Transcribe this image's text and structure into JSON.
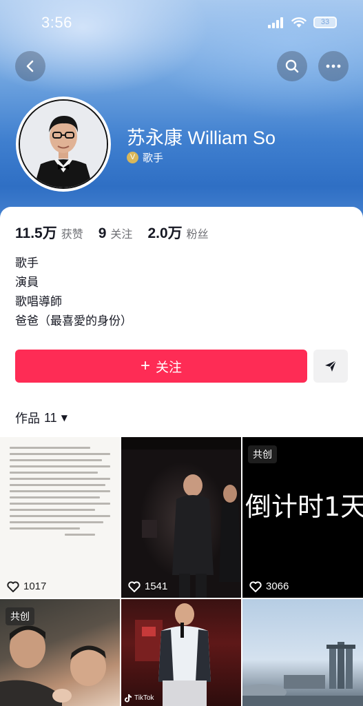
{
  "status_bar": {
    "time": "3:56",
    "battery": "33"
  },
  "profile": {
    "name": "苏永康 William So",
    "verified_label": "歌手",
    "verified_mark": "V"
  },
  "stats": [
    {
      "value": "11.5万",
      "label": "获赞"
    },
    {
      "value": "9",
      "label": "关注"
    },
    {
      "value": "2.0万",
      "label": "粉丝"
    }
  ],
  "bio": [
    "歌手",
    "演員",
    "歌唱導師",
    "爸爸（最喜愛的身份）"
  ],
  "actions": {
    "follow_label": "关注",
    "follow_plus": "+"
  },
  "works": {
    "label": "作品",
    "count": "11",
    "caret": "▼"
  },
  "videos": [
    {
      "likes": "1017",
      "badge": ""
    },
    {
      "likes": "1541",
      "badge": ""
    },
    {
      "likes": "3066",
      "badge": "共创",
      "overlay_text": "倒计时1天"
    },
    {
      "likes": "",
      "badge": "共创"
    },
    {
      "likes": "",
      "badge": "",
      "watermark": "TikTok"
    },
    {
      "likes": "",
      "badge": ""
    }
  ],
  "colors": {
    "accent": "#fe2c55",
    "header_blue": "#3f7fcf",
    "verified_gold": "#d9b75a"
  },
  "icons": [
    "back-icon",
    "search-icon",
    "more-icon",
    "share-icon",
    "heart-icon",
    "signal-icon",
    "wifi-icon"
  ]
}
